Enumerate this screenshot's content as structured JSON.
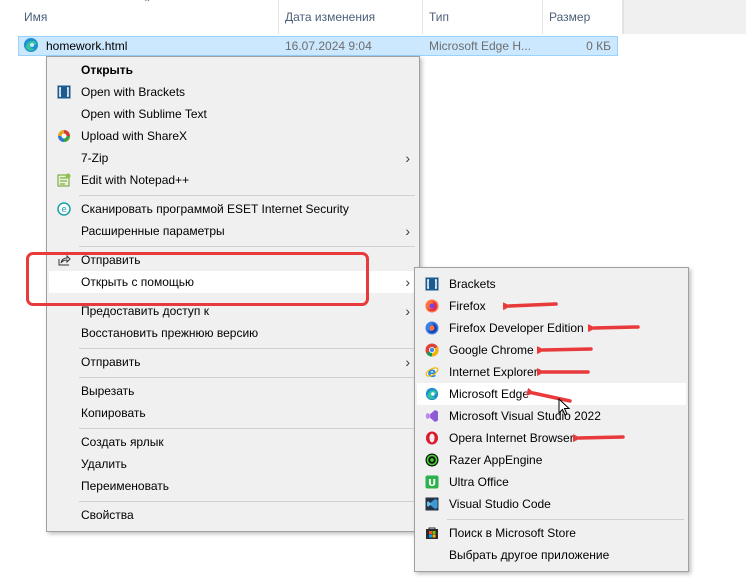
{
  "columns": {
    "name": "Имя",
    "date": "Дата изменения",
    "type": "Тип",
    "size": "Размер"
  },
  "file": {
    "name": "homework.html",
    "date": "16.07.2024 9:04",
    "type": "Microsoft Edge H...",
    "size": "0 КБ",
    "icon": "edge-icon"
  },
  "context_menu": {
    "open": "Открыть",
    "brackets": "Open with Brackets",
    "sublime": "Open with Sublime Text",
    "sharex": "Upload with ShareX",
    "zip": "7-Zip",
    "notepadpp": "Edit with Notepad++",
    "eset": "Сканировать программой ESET Internet Security",
    "advanced": "Расширенные параметры",
    "share": "Отправить",
    "open_with": "Открыть с помощью",
    "give_access": "Предоставить доступ к",
    "restore": "Восстановить прежнюю версию",
    "send_to": "Отправить",
    "cut": "Вырезать",
    "copy": "Копировать",
    "shortcut": "Создать ярлык",
    "delete": "Удалить",
    "rename": "Переименовать",
    "properties": "Свойства"
  },
  "open_with_menu": {
    "brackets": "Brackets",
    "firefox": "Firefox",
    "firefox_dev": "Firefox Developer Edition",
    "chrome": "Google Chrome",
    "ie": "Internet Explorer",
    "edge": "Microsoft Edge",
    "vs2022": "Microsoft Visual Studio 2022",
    "opera": "Opera Internet Browser",
    "razer": "Razer AppEngine",
    "ultra": "Ultra Office",
    "vscode": "Visual Studio Code",
    "store": "Поиск в Microsoft Store",
    "other": "Выбрать другое приложение"
  },
  "colors": {
    "annotation_red": "#e8393b",
    "selection": "#cce8ff",
    "menu_bg": "#f0f0f0"
  }
}
